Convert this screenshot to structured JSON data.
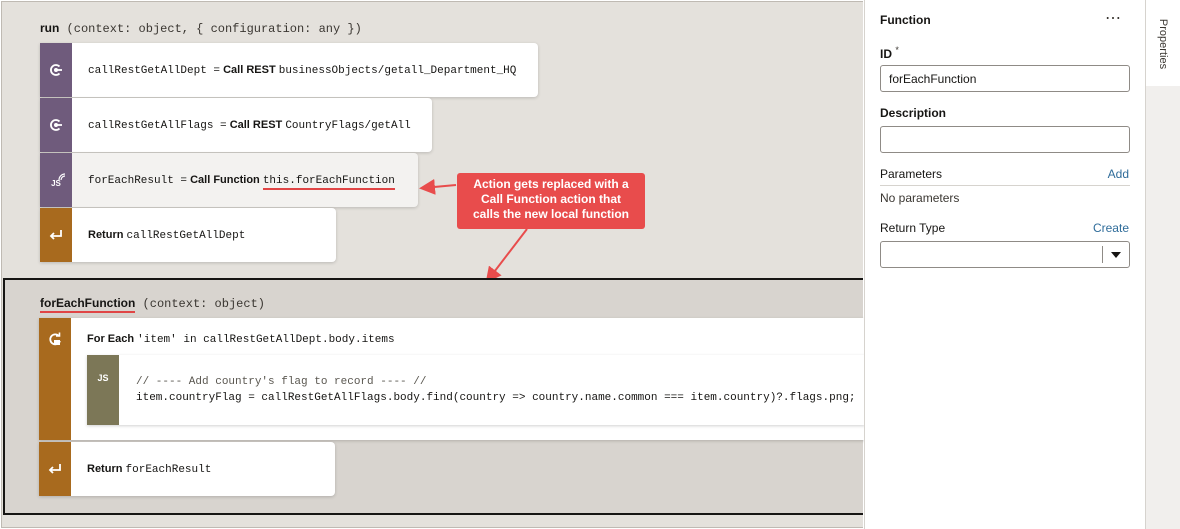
{
  "run_signature": {
    "name": "run",
    "params": "(context: object, { configuration: any })"
  },
  "run_actions": [
    {
      "lhs": "callRestGetAllDept =",
      "keyword": "Call REST",
      "target": "businessObjects/getall_Department_HQ"
    },
    {
      "lhs": "callRestGetAllFlags =",
      "keyword": "Call REST",
      "target": "CountryFlags/getAll"
    },
    {
      "lhs": "forEachResult =",
      "keyword": "Call Function",
      "target_prefix": "this.",
      "target": "forEachFunction",
      "icon_label": "JS"
    },
    {
      "keyword": "Return",
      "target": "callRestGetAllDept"
    }
  ],
  "callout": {
    "text": "Action gets replaced with a Call Function action that calls the new local function",
    "line1": "Action gets replaced with a",
    "line2": "Call Function action that",
    "line3": "calls the new local function"
  },
  "function_signature": {
    "name": "forEachFunction",
    "params": "(context: object)"
  },
  "function_actions": {
    "foreach": {
      "keyword": "For Each",
      "target": "'item' in callRestGetAllDept.body.items"
    },
    "js": {
      "icon_label": "JS",
      "line1": "// ---- Add country's flag to record ---- //",
      "line2": "item.countryFlag = callRestGetAllFlags.body.find(country => country.name.common === item.country)?.flags.png;"
    },
    "return": {
      "keyword": "Return",
      "target": "forEachResult"
    }
  },
  "panel": {
    "title": "Function",
    "more_label": "⋯",
    "id_label": "ID",
    "id_required": "*",
    "id_value": "forEachFunction",
    "description_label": "Description",
    "description_value": "",
    "parameters_label": "Parameters",
    "parameters_add": "Add",
    "parameters_empty": "No parameters",
    "return_type_label": "Return Type",
    "return_type_create": "Create",
    "return_type_value": ""
  },
  "side_tab": {
    "label": "Properties"
  },
  "colors": {
    "callout": "#e84c4c",
    "action_purple": "#6f5b7c",
    "action_orange": "#a86a1e",
    "js_olive": "#7c7757",
    "link": "#2f6c9a"
  }
}
